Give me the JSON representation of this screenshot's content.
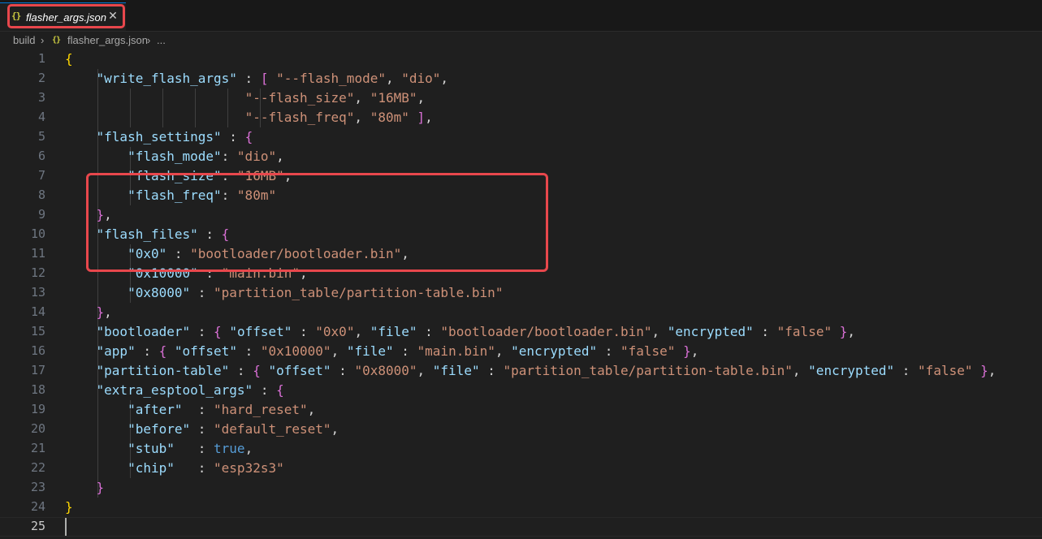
{
  "tab": {
    "icon": "json-braces-icon",
    "label": "flasher_args.json",
    "close_glyph": "✕"
  },
  "breadcrumb": {
    "folder": "build",
    "sep": "›",
    "file_icon": "json-braces-icon",
    "icon_glyph": "{}",
    "file": "flasher_args.json",
    "more": "..."
  },
  "colors": {
    "key": "#9cdcfe",
    "string": "#ce9178",
    "bracket1": "#ffd700",
    "bracket2": "#da70d6",
    "bracket3": "#179fff",
    "keyword": "#569cd6",
    "highlight": "#e8474c"
  },
  "lines": [
    {
      "num": "1"
    },
    {
      "num": "2"
    },
    {
      "num": "3"
    },
    {
      "num": "4"
    },
    {
      "num": "5"
    },
    {
      "num": "6"
    },
    {
      "num": "7"
    },
    {
      "num": "8"
    },
    {
      "num": "9"
    },
    {
      "num": "10"
    },
    {
      "num": "11"
    },
    {
      "num": "12"
    },
    {
      "num": "13"
    },
    {
      "num": "14"
    },
    {
      "num": "15"
    },
    {
      "num": "16"
    },
    {
      "num": "17"
    },
    {
      "num": "18"
    },
    {
      "num": "19"
    },
    {
      "num": "20"
    },
    {
      "num": "21"
    },
    {
      "num": "22"
    },
    {
      "num": "23"
    },
    {
      "num": "24"
    },
    {
      "num": "25"
    }
  ],
  "json": {
    "k_write_flash_args": "\"write_flash_args\"",
    "s_flash_mode_arg": "\"--flash_mode\"",
    "s_dio": "\"dio\"",
    "s_flash_size_arg": "\"--flash_size\"",
    "s_16mb": "\"16MB\"",
    "s_flash_freq_arg": "\"--flash_freq\"",
    "s_80m": "\"80m\"",
    "k_flash_settings": "\"flash_settings\"",
    "k_flash_mode": "\"flash_mode\"",
    "k_flash_size": "\"flash_size\"",
    "k_flash_freq": "\"flash_freq\"",
    "k_flash_files": "\"flash_files\"",
    "k_0x0": "\"0x0\"",
    "s_bootloader_bin": "\"bootloader/bootloader.bin\"",
    "k_0x10000": "\"0x10000\"",
    "s_main_bin": "\"main.bin\"",
    "k_0x8000": "\"0x8000\"",
    "s_partition_bin": "\"partition_table/partition-table.bin\"",
    "k_bootloader": "\"bootloader\"",
    "k_offset": "\"offset\"",
    "s_0x0": "\"0x0\"",
    "k_file": "\"file\"",
    "k_encrypted": "\"encrypted\"",
    "s_false": "\"false\"",
    "k_app": "\"app\"",
    "s_0x10000": "\"0x10000\"",
    "k_partition_table": "\"partition-table\"",
    "s_0x8000": "\"0x8000\"",
    "k_extra_esptool_args": "\"extra_esptool_args\"",
    "k_after": "\"after\"",
    "s_hard_reset": "\"hard_reset\"",
    "k_before": "\"before\"",
    "s_default_reset": "\"default_reset\"",
    "k_stub": "\"stub\"",
    "v_true": "true",
    "k_chip": "\"chip\"",
    "s_esp32s3": "\"esp32s3\""
  }
}
